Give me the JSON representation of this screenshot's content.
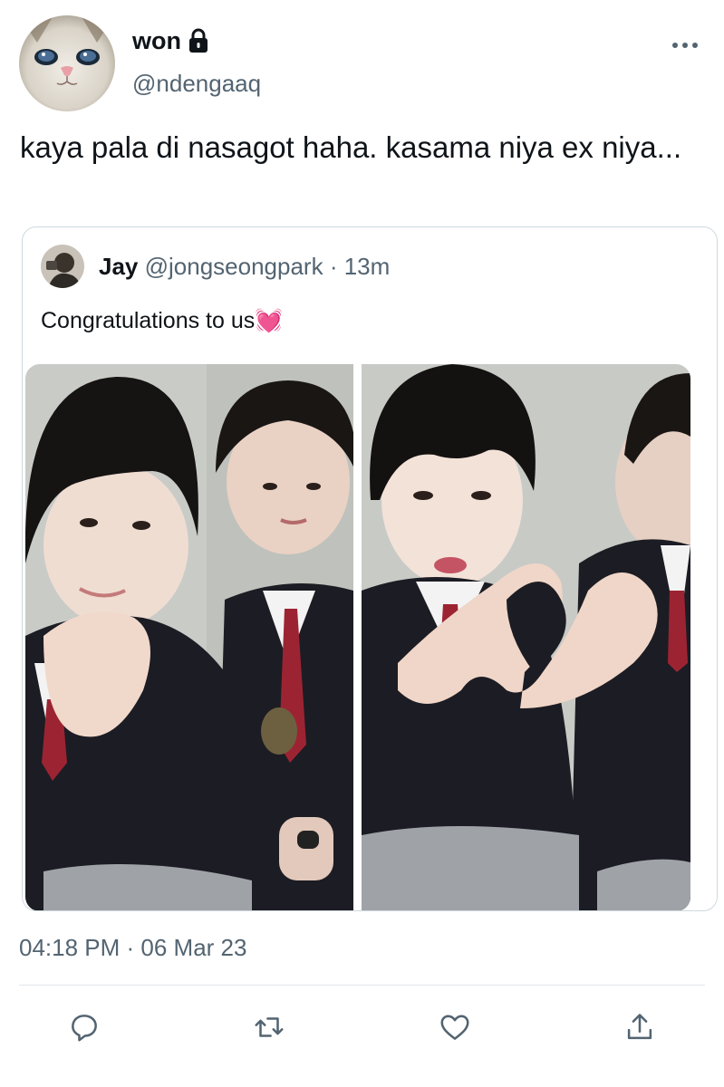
{
  "author": {
    "display_name": "won",
    "handle": "@ndengaaq",
    "avatar": "cat-face-avatar",
    "protected_icon": "lock-icon"
  },
  "more_icon": "more-horizontal-icon",
  "tweet": {
    "text": "kaya pala di nasagot haha. kasama niya ex niya..."
  },
  "quote": {
    "name": "Jay",
    "handle": "@jongseongpark",
    "separator": " · ",
    "time": "13m",
    "text": "Congratulations to us💓",
    "photos": [
      "photo-booth-left",
      "photo-booth-right"
    ]
  },
  "timestamp": "04:18 PM · 06 Mar 23",
  "actions": [
    {
      "name": "reply",
      "icon": "reply-icon"
    },
    {
      "name": "retweet",
      "icon": "retweet-icon"
    },
    {
      "name": "like",
      "icon": "heart-icon"
    },
    {
      "name": "share",
      "icon": "share-icon"
    }
  ],
  "colors": {
    "text_primary": "#0f1419",
    "text_secondary": "#536471",
    "border": "#cfd9de",
    "icon": "#536471"
  }
}
